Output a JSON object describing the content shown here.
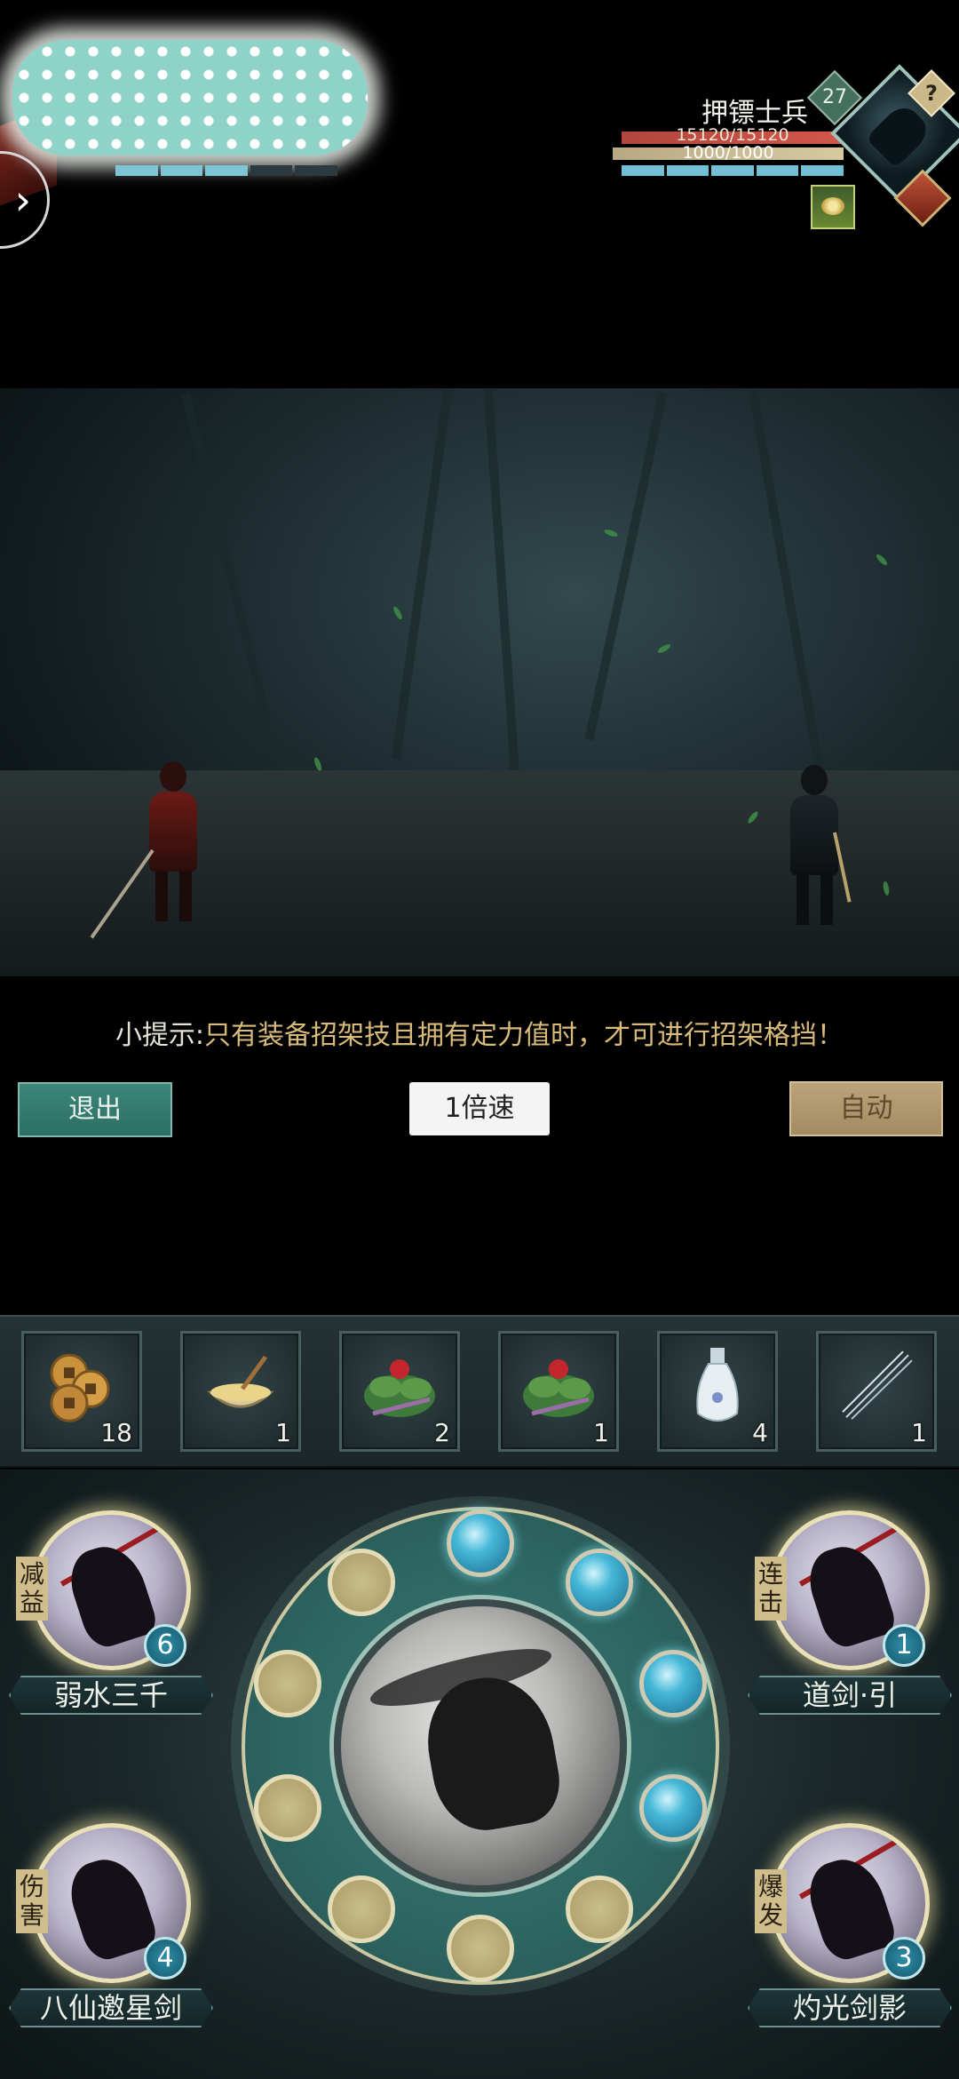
{
  "enemy": {
    "name": "押镖士兵",
    "level": "27",
    "hp_text": "15120/15120",
    "mp_text": "1000/1000",
    "help_label": "?"
  },
  "controls": {
    "expand_label": "›",
    "exit_label": "退出",
    "speed_label": "1倍速",
    "auto_label": "自动"
  },
  "tip": {
    "lead": "小提示:",
    "body": "只有装备招架技且拥有定力值时，才可进行招架格挡！"
  },
  "items": [
    {
      "icon": "copper-coins-icon",
      "count": "18"
    },
    {
      "icon": "food-bowl-icon",
      "count": "1"
    },
    {
      "icon": "red-flower-herb-icon",
      "count": "2"
    },
    {
      "icon": "red-flower-herb-icon",
      "count": "1"
    },
    {
      "icon": "porcelain-bottle-icon",
      "count": "4"
    },
    {
      "icon": "needles-icon",
      "count": "1"
    }
  ],
  "skills": {
    "top_left": {
      "tag": "减益",
      "name": "弱水三千",
      "level": "6"
    },
    "top_right": {
      "tag": "连击",
      "name": "道剑·引",
      "level": "1"
    },
    "bottom_left": {
      "tag": "伤害",
      "name": "八仙邀星剑",
      "level": "4"
    },
    "bottom_right": {
      "tag": "爆发",
      "name": "灼光剑影",
      "level": "3"
    }
  },
  "energy_slots": {
    "filled": 4,
    "total": 10
  },
  "colors": {
    "exit": "#2d6f63",
    "auto": "#a38a60",
    "tip_highlight": "#d9bb79",
    "filled_slot": "#46b8d8",
    "empty_slot": "#b3a56f"
  }
}
